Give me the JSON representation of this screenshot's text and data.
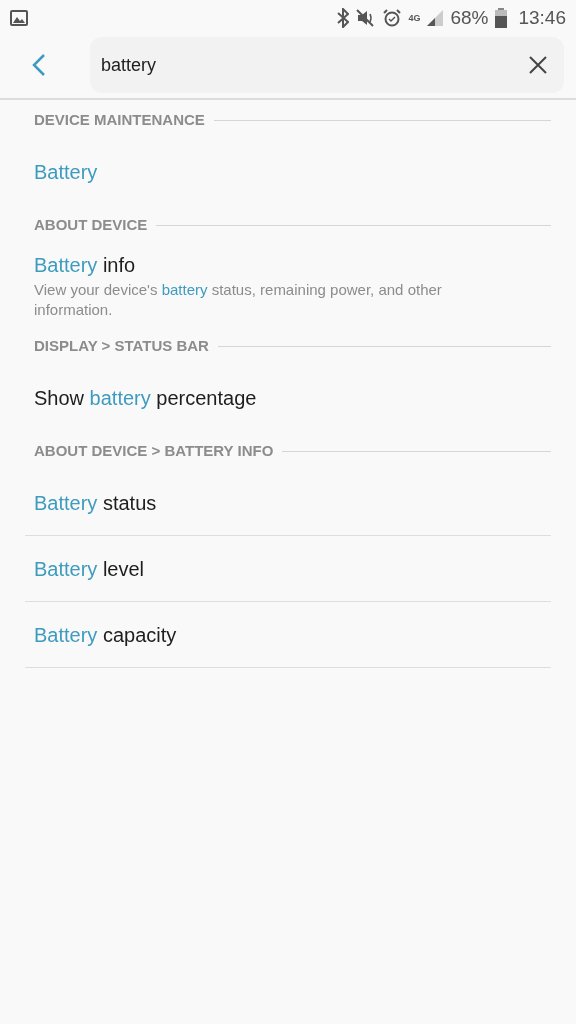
{
  "status_bar": {
    "network": "4G",
    "battery": "68%",
    "time": "13:46"
  },
  "search": {
    "value": "battery"
  },
  "sections": [
    {
      "header": "DEVICE MAINTENANCE",
      "divided": false,
      "items": [
        {
          "title": [
            {
              "text": "Battery",
              "highlight": true
            }
          ]
        }
      ]
    },
    {
      "header": "ABOUT DEVICE",
      "divided": false,
      "items": [
        {
          "title": [
            {
              "text": "Battery",
              "highlight": true
            },
            {
              "text": " info",
              "highlight": false
            }
          ],
          "description": [
            {
              "text": "View your device's ",
              "highlight": false
            },
            {
              "text": "battery",
              "highlight": true
            },
            {
              "text": " status, remaining power, and other information.",
              "highlight": false
            }
          ]
        }
      ]
    },
    {
      "header": "DISPLAY > STATUS BAR",
      "divided": false,
      "items": [
        {
          "title": [
            {
              "text": "Show ",
              "highlight": false
            },
            {
              "text": "battery",
              "highlight": true
            },
            {
              "text": " percentage",
              "highlight": false
            }
          ]
        }
      ]
    },
    {
      "header": "ABOUT DEVICE > BATTERY INFO",
      "divided": true,
      "items": [
        {
          "title": [
            {
              "text": "Battery",
              "highlight": true
            },
            {
              "text": " status",
              "highlight": false
            }
          ]
        },
        {
          "title": [
            {
              "text": "Battery",
              "highlight": true
            },
            {
              "text": " level",
              "highlight": false
            }
          ]
        },
        {
          "title": [
            {
              "text": "Battery",
              "highlight": true
            },
            {
              "text": " capacity",
              "highlight": false
            }
          ]
        }
      ]
    }
  ]
}
